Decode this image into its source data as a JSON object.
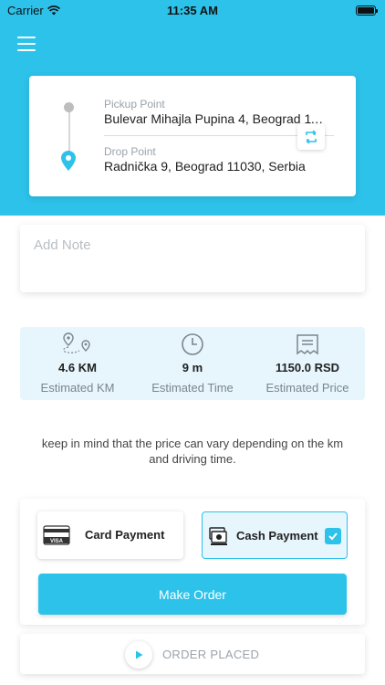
{
  "status_bar": {
    "carrier": "Carrier",
    "time": "11:35 AM"
  },
  "theme": {
    "accent": "#2dc2ea",
    "accent_light": "#e6f6fc"
  },
  "route": {
    "pickup_label": "Pickup Point",
    "pickup_value": "Bulevar Mihajla Pupina 4, Beograd 11070, Serbia",
    "drop_label": "Drop Point",
    "drop_value": "Radnička 9, Beograd 11030, Serbia"
  },
  "note": {
    "placeholder": "Add Note"
  },
  "stats": [
    {
      "icon": "route-pin-icon",
      "value": "4.6 KM",
      "label": "Estimated KM"
    },
    {
      "icon": "clock-icon",
      "value": "9 m",
      "label": "Estimated Time"
    },
    {
      "icon": "receipt-icon",
      "value": "1150.0 RSD",
      "label": "Estimated Price"
    }
  ],
  "info_text": "keep in mind that the price can vary  depending on the km and driving time.",
  "payment": {
    "options": [
      {
        "icon": "visa-card-icon",
        "label": "Card Payment",
        "selected": false
      },
      {
        "icon": "cash-icon",
        "label": "Cash Payment",
        "selected": true
      }
    ],
    "make_order_label": "Make Order"
  },
  "order_status": {
    "label": "ORDER PLACED"
  }
}
